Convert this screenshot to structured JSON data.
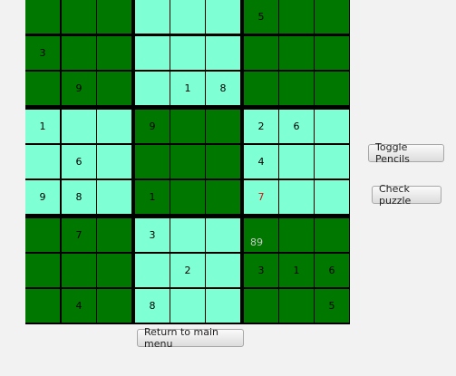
{
  "board": {
    "grid": [
      [
        "",
        "",
        "",
        "",
        "",
        "",
        "5",
        "",
        ""
      ],
      [
        "3",
        "",
        "",
        "",
        "",
        "",
        "",
        "",
        ""
      ],
      [
        "",
        "9",
        "",
        "",
        "1",
        "8",
        "",
        "",
        ""
      ],
      [
        "1",
        "",
        "",
        "9",
        "",
        "",
        "2",
        "6",
        ""
      ],
      [
        "",
        "6",
        "",
        "",
        "",
        "",
        "4",
        "",
        ""
      ],
      [
        "9",
        "8",
        "",
        "1",
        "",
        "",
        "7",
        "",
        ""
      ],
      [
        "",
        "7",
        "",
        "3",
        "",
        "",
        "",
        "",
        ""
      ],
      [
        "",
        "",
        "",
        "",
        "2",
        "",
        "3",
        "1",
        "6"
      ],
      [
        "",
        "4",
        "",
        "8",
        "",
        "",
        "",
        "",
        "5"
      ]
    ],
    "pencil_marks": [
      {
        "row": 6,
        "col": 6,
        "text": "89"
      }
    ],
    "error_cells": [
      {
        "row": 5,
        "col": 6
      }
    ],
    "colors": {
      "dark_box": "#007800",
      "light_box": "#7fffd4",
      "error_digit": "#e01010",
      "pencil": "#c8c8c8"
    }
  },
  "buttons": {
    "toggle_pencils": "Toggle Pencils",
    "check_puzzle": "Check puzzle",
    "return_menu": "Return to main menu"
  }
}
